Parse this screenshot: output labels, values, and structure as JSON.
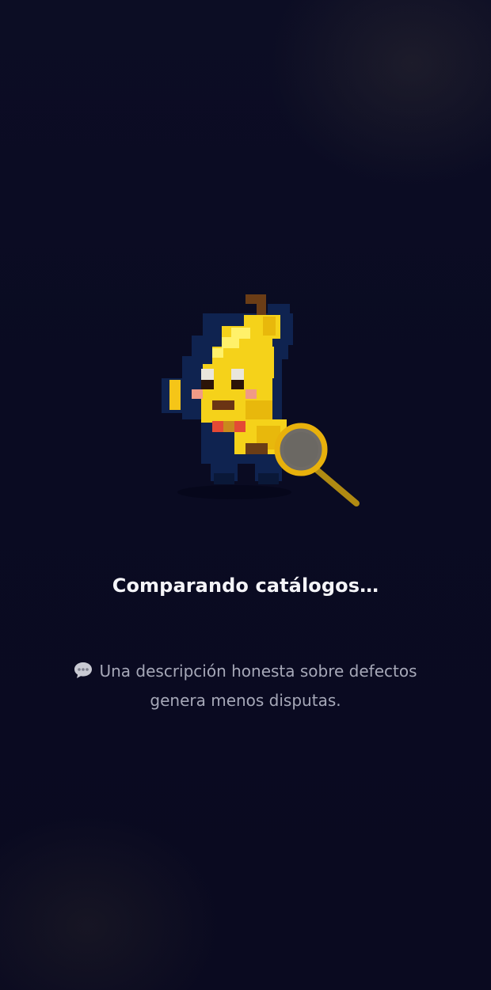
{
  "loading": {
    "title": "Comparando catálogos…",
    "tip": "Una descripción honesta sobre defectos genera menos disputas.",
    "tip_icon": "speech-bubble-icon"
  },
  "mascot": {
    "name": "banana-detective-mascot",
    "colors": {
      "banana": "#f5d21a",
      "banana_shadow": "#e8b80c",
      "outline": "#0f2350",
      "stem": "#6b3d16",
      "magnifier_rim": "#e8b10c",
      "magnifier_lens": "#6f6b66"
    }
  },
  "theme": {
    "background": "#0b0c22",
    "title_color": "#f4f4f8",
    "tip_color": "#a6a8b8"
  }
}
